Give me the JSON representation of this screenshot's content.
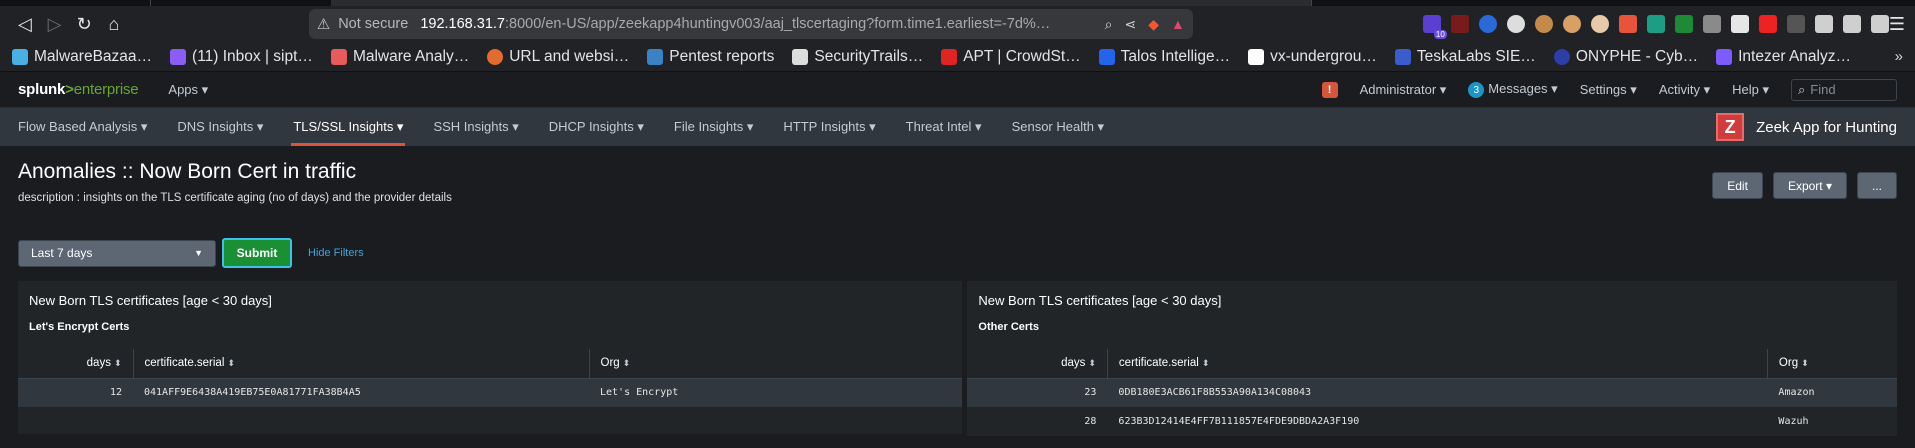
{
  "browser": {
    "url_warning_label": "Not secure",
    "url_host": "192.168.31.7",
    "url_path": ":8000/en-US/app/zeekapp4huntingv003/aaj_tlscertaging?form.time1.earliest=-7d%…",
    "extension_badge": "10",
    "bookmarks": [
      {
        "label": "MalwareBazaa…",
        "icon": "mb-icon",
        "color": "#4ab0e3"
      },
      {
        "label": "(11) Inbox | sipt…",
        "icon": "proton-mail-icon",
        "color": "#8b5cf6"
      },
      {
        "label": "Malware Analy…",
        "icon": "malware-analysis-icon",
        "color": "#e85b5b"
      },
      {
        "label": "URL and websi…",
        "icon": "url-scan-icon",
        "color": "#e26b2d"
      },
      {
        "label": "Pentest reports",
        "icon": "pentest-icon",
        "color": "#3b82c4"
      },
      {
        "label": "SecurityTrails…",
        "icon": "securitytrails-icon",
        "color": "#dddddd"
      },
      {
        "label": "APT | CrowdSt…",
        "icon": "crowdstrike-icon",
        "color": "#e02424"
      },
      {
        "label": "Talos Intellige…",
        "icon": "talos-icon",
        "color": "#2563eb"
      },
      {
        "label": "vx-undergrou…",
        "icon": "vx-icon",
        "color": "#ffffff"
      },
      {
        "label": "TeskaLabs SIE…",
        "icon": "teskalabs-icon",
        "color": "#3b5ccc"
      },
      {
        "label": "ONYPHE - Cyb…",
        "icon": "onyphe-icon",
        "color": "#2b3fa6"
      },
      {
        "label": "Intezer Analyz…",
        "icon": "intezer-icon",
        "color": "#7c5cff"
      }
    ]
  },
  "splunk": {
    "logo_brand": "splunk",
    "logo_product": "enterprise",
    "apps_label": "Apps ▾",
    "alert_badge": "!",
    "user_label": "Administrator ▾",
    "messages_count": "3",
    "messages_label": "Messages ▾",
    "settings_label": "Settings ▾",
    "activity_label": "Activity ▾",
    "help_label": "Help ▾",
    "find_placeholder": "Find"
  },
  "app_nav": {
    "items": [
      {
        "label": "Flow Based Analysis ▾",
        "active": false
      },
      {
        "label": "DNS Insights ▾",
        "active": false
      },
      {
        "label": "TLS/SSL Insights ▾",
        "active": true
      },
      {
        "label": "SSH Insights ▾",
        "active": false
      },
      {
        "label": "DHCP Insights ▾",
        "active": false
      },
      {
        "label": "File Insights ▾",
        "active": false
      },
      {
        "label": "HTTP Insights ▾",
        "active": false
      },
      {
        "label": "Threat Intel ▾",
        "active": false
      },
      {
        "label": "Sensor Health ▾",
        "active": false
      }
    ],
    "app_icon_letter": "Z",
    "app_title": "Zeek App for Hunting"
  },
  "dashboard": {
    "title": "Anomalies :: Now Born Cert in traffic",
    "description": "description : insights on the TLS certificate aging (no of days) and the provider details",
    "edit_label": "Edit",
    "export_label": "Export ▾",
    "more_label": "...",
    "time_picker_value": "Last 7 days",
    "submit_label": "Submit",
    "hide_filters_label": "Hide Filters"
  },
  "panels": [
    {
      "title": "New Born TLS certificates [age < 30 days]",
      "subtitle": "Let's Encrypt Certs",
      "columns": [
        "days",
        "certificate.serial",
        "Org"
      ],
      "rows": [
        {
          "days": "12",
          "serial": "041AFF9E6438A419EB75E0A81771FA38B4A5",
          "org": "Let's Encrypt"
        }
      ]
    },
    {
      "title": "New Born TLS certificates [age < 30 days]",
      "subtitle": "Other Certs",
      "columns": [
        "days",
        "certificate.serial",
        "Org"
      ],
      "rows": [
        {
          "days": "23",
          "serial": "0DB180E3ACB61F8B553A90A134C08043",
          "org": "Amazon"
        },
        {
          "days": "28",
          "serial": "623B3D12414E4FF7B111857E4FDE9DBDA2A3F190",
          "org": "Wazuh"
        }
      ]
    }
  ]
}
